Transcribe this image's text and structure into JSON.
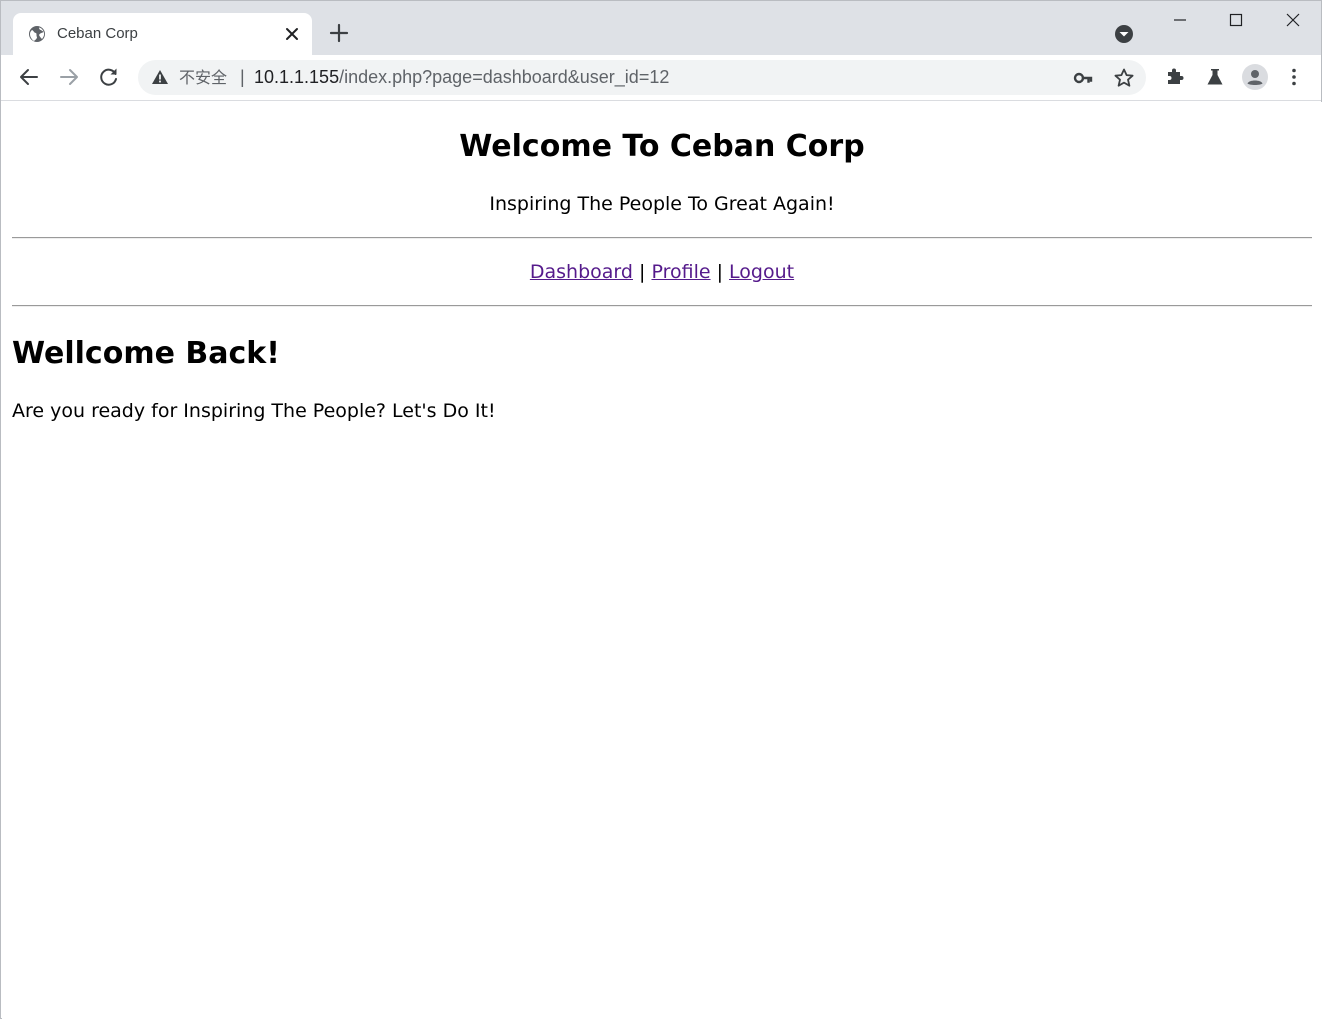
{
  "browser": {
    "tab_title": "Ceban Corp",
    "security_label": "不安全",
    "security_separator": "|",
    "url_host": "10.1.1.155",
    "url_path": "/index.php?page=dashboard&user_id=12"
  },
  "page": {
    "title": "Welcome To Ceban Corp",
    "tagline": "Inspiring The People To Great Again!",
    "nav": {
      "dashboard": "Dashboard",
      "profile": "Profile",
      "logout": "Logout",
      "separator": "|"
    },
    "welcome_heading": "Wellcome Back!",
    "welcome_text": "Are you ready for Inspiring The People? Let's Do It!"
  },
  "colors": {
    "tabstrip_bg": "#dee1e6",
    "omnibox_bg": "#f1f3f4",
    "visited_link": "#551a8b"
  },
  "icons": {
    "favicon": "globe-icon",
    "tab_close": "close-icon",
    "new_tab": "plus-icon",
    "tab_search": "chevron-down-circle-icon",
    "back": "arrow-left-icon",
    "forward": "arrow-right-icon",
    "reload": "reload-icon",
    "warning": "warning-icon",
    "key": "key-icon",
    "bookmark": "star-icon",
    "extensions": "puzzle-icon",
    "labs": "flask-icon",
    "profile": "avatar-icon",
    "menu": "kebab-menu-icon"
  }
}
